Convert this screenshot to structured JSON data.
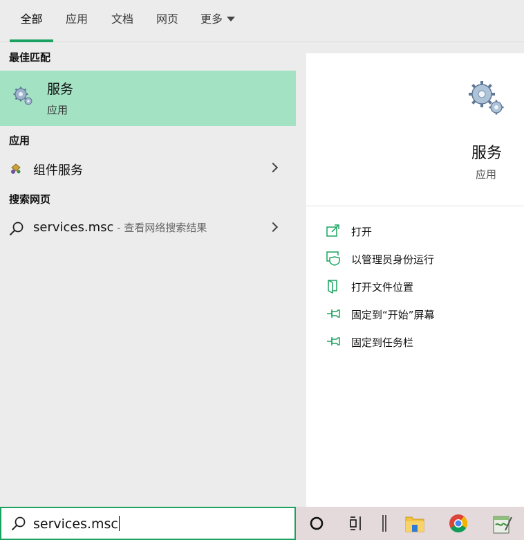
{
  "tabs": [
    {
      "label": "全部",
      "active": true
    },
    {
      "label": "应用",
      "active": false
    },
    {
      "label": "文档",
      "active": false
    },
    {
      "label": "网页",
      "active": false
    },
    {
      "label": "更多",
      "active": false
    }
  ],
  "sections": {
    "best_match": "最佳匹配",
    "apps": "应用",
    "web": "搜索网页"
  },
  "best_match": {
    "title": "服务",
    "subtitle": "应用"
  },
  "apps": [
    {
      "label": "组件服务"
    }
  ],
  "web_results": [
    {
      "query": "services.msc",
      "suffix": " - 查看网络搜索结果"
    }
  ],
  "preview": {
    "title": "服务",
    "subtitle": "应用",
    "actions": [
      {
        "label": "打开",
        "icon": "open-icon"
      },
      {
        "label": "以管理员身份运行",
        "icon": "shield-run-as-admin-icon"
      },
      {
        "label": "打开文件位置",
        "icon": "file-location-icon"
      },
      {
        "label": "固定到“开始”屏幕",
        "icon": "pin-icon"
      },
      {
        "label": "固定到任务栏",
        "icon": "pin-icon"
      }
    ]
  },
  "search": {
    "value": "services.msc"
  },
  "colors": {
    "accent": "#1aa260",
    "selected_bg": "#a4e2c4",
    "pane_bg": "#ececec"
  }
}
